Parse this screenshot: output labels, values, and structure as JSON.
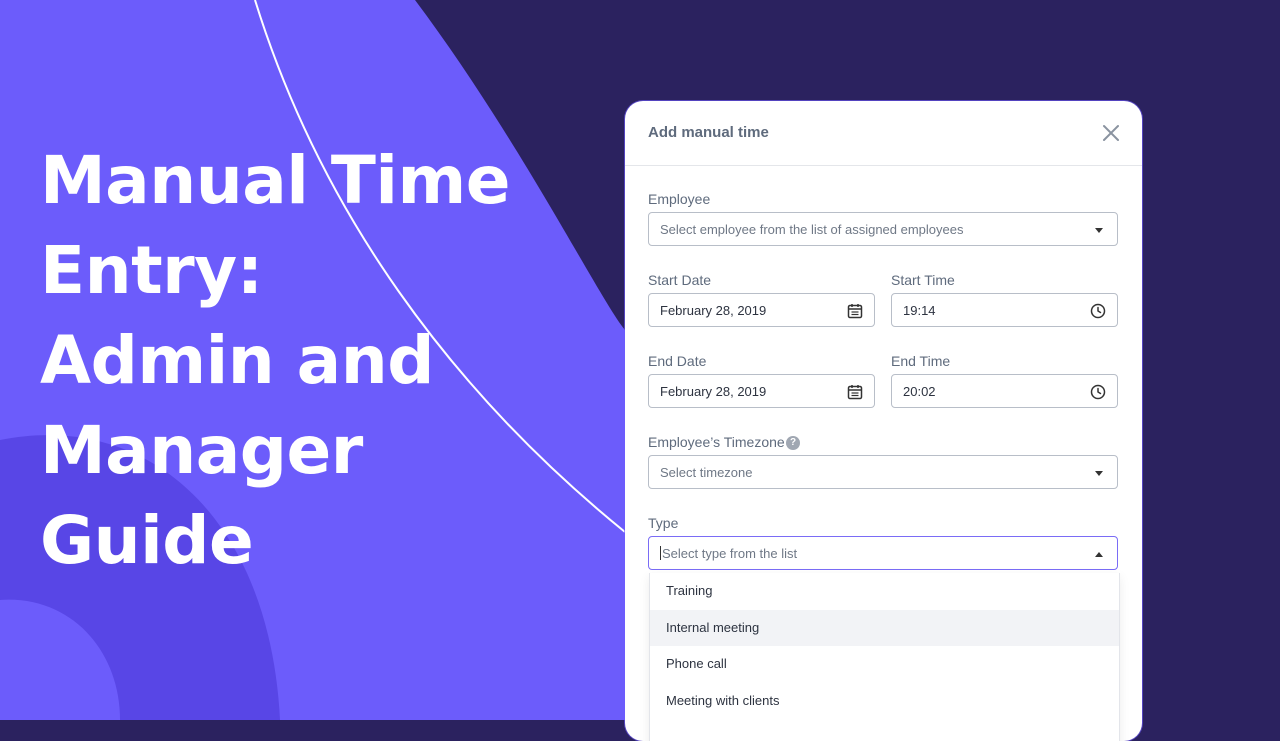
{
  "headline": {
    "lines": [
      "Manual Time",
      "Entry:",
      "Admin and",
      "Manager",
      "Guide"
    ]
  },
  "colors": {
    "bg_dark": "#2b225f",
    "bg_purple": "#6c5cfb",
    "bg_purple_deep": "#5846e6",
    "accent": "#7a6cf6"
  },
  "dialog": {
    "title": "Add manual time",
    "close_icon": "close-icon",
    "employee": {
      "label": "Employee",
      "placeholder": "Select employee from the list of assigned employees"
    },
    "start_date": {
      "label": "Start Date",
      "value": "February 28, 2019"
    },
    "start_time": {
      "label": "Start Time",
      "value": "19:14"
    },
    "end_date": {
      "label": "End Date",
      "value": "February 28, 2019"
    },
    "end_time": {
      "label": "End Time",
      "value": "20:02"
    },
    "timezone": {
      "label": "Employee’s Timezone",
      "help": "?",
      "placeholder": "Select timezone"
    },
    "type": {
      "label": "Type",
      "placeholder": "Select type from the list",
      "options": [
        "Training",
        "Internal meeting",
        "Phone call",
        "Meeting with clients"
      ]
    }
  }
}
